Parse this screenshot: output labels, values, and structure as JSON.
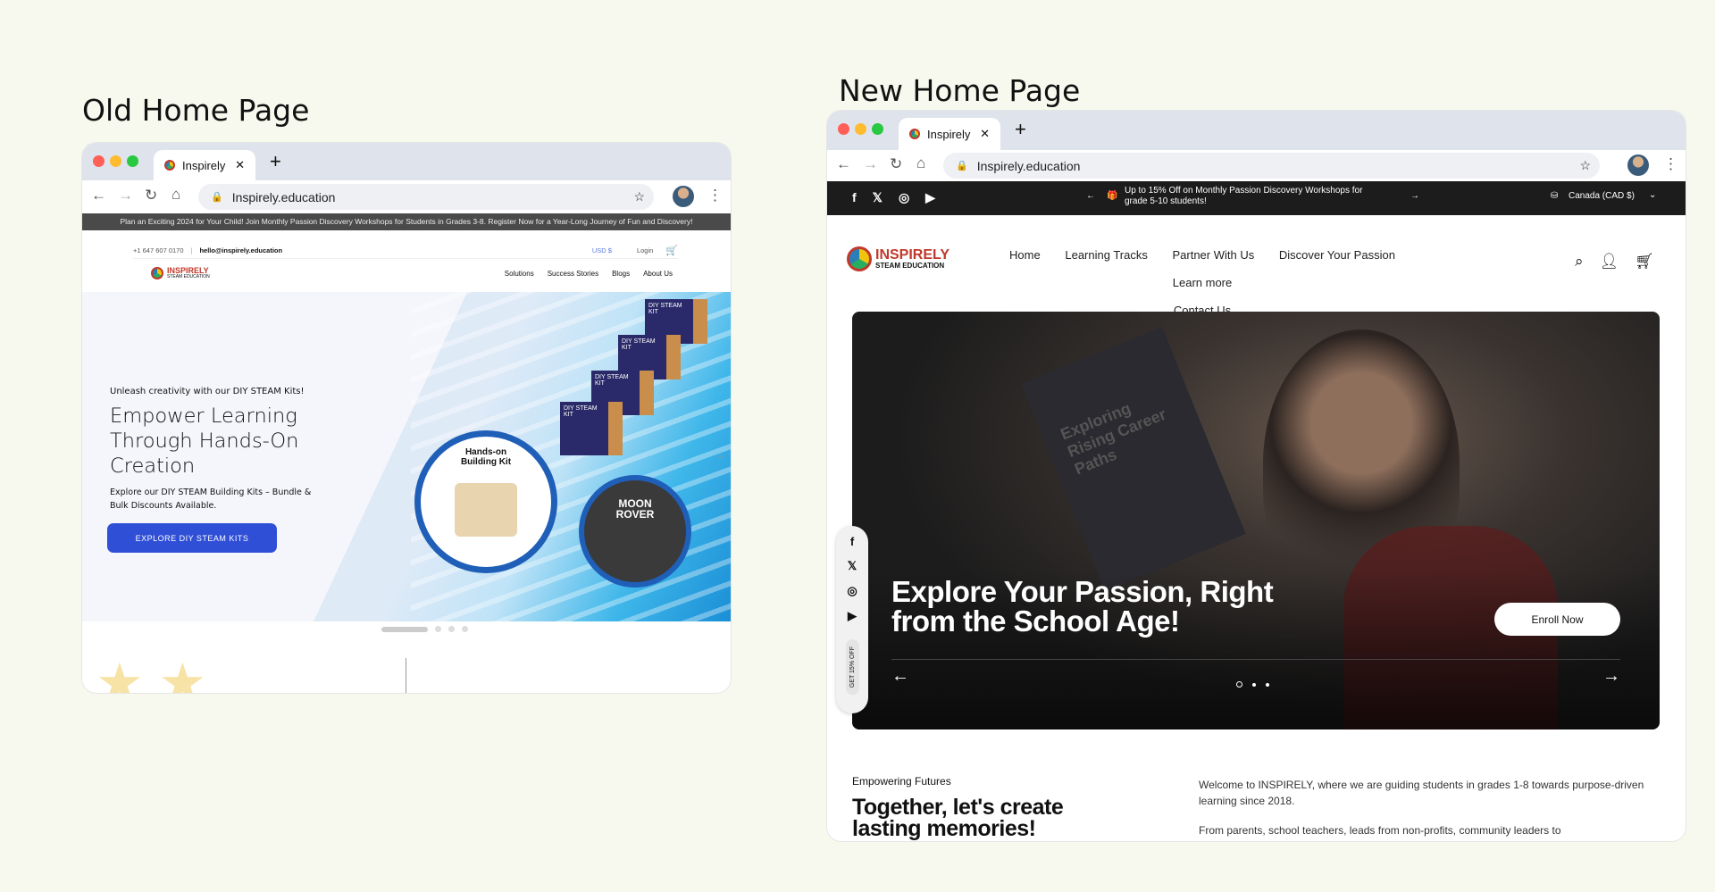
{
  "old": {
    "heading": "Old Home Page",
    "tab_title": "Inspirely",
    "url": "Inspirely.education",
    "announcement": "Plan an Exciting 2024 for Your Child! Join Monthly Passion Discovery Workshops for Students in Grades 3-8. Register Now for a Year-Long Journey of Fun and Discovery!",
    "phone": "+1 647 607 0170",
    "email": "hello@inspirely.education",
    "currency": "USD $",
    "login": "Login",
    "logo_name": "INSPIRELY",
    "logo_sub": "STEAM EDUCATION",
    "nav": [
      "Solutions",
      "Success Stories",
      "Blogs",
      "About Us"
    ],
    "hero": {
      "eyebrow": "Unleash creativity with our DIY STEAM Kits!",
      "title": "Empower Learning Through Hands-On Creation",
      "subtitle": "Explore our DIY STEAM Building Kits – Bundle & Bulk Discounts Available.",
      "cta": "EXPLORE DIY STEAM KITS",
      "kit_label": "DIY STEAM KIT",
      "circle1": "Hands-on Building Kit",
      "circle2": "MOON ROVER"
    },
    "accent": "#2f4fd6"
  },
  "new": {
    "heading": "New Home Page",
    "tab_title": "Inspirely",
    "url": "Inspirely.education",
    "promo": "Up to 15% Off on Monthly Passion Discovery Workshops for grade 5-10 students!",
    "region": "Canada (CAD $)",
    "logo_name": "INSPIRELY",
    "logo_sub": "STEAM EDUCATION",
    "nav": [
      "Home",
      "Learning Tracks",
      "Partner With Us",
      "Discover Your Passion",
      "Learn more",
      "Contact Us"
    ],
    "hero": {
      "title": "Explore Your Passion, Right from the School Age!",
      "cta": "Enroll Now",
      "side_offer": "GET 15% OFF",
      "book_text": "Exploring Rising Career Paths"
    },
    "section": {
      "eyebrow": "Empowering Futures",
      "title": "Together, let's create lasting memories!",
      "para1": "Welcome to INSPIRELY, where we are guiding students in grades 1-8 towards purpose-driven learning since 2018.",
      "para2": "From parents, school teachers, leads from non-profits, community leaders to"
    }
  }
}
